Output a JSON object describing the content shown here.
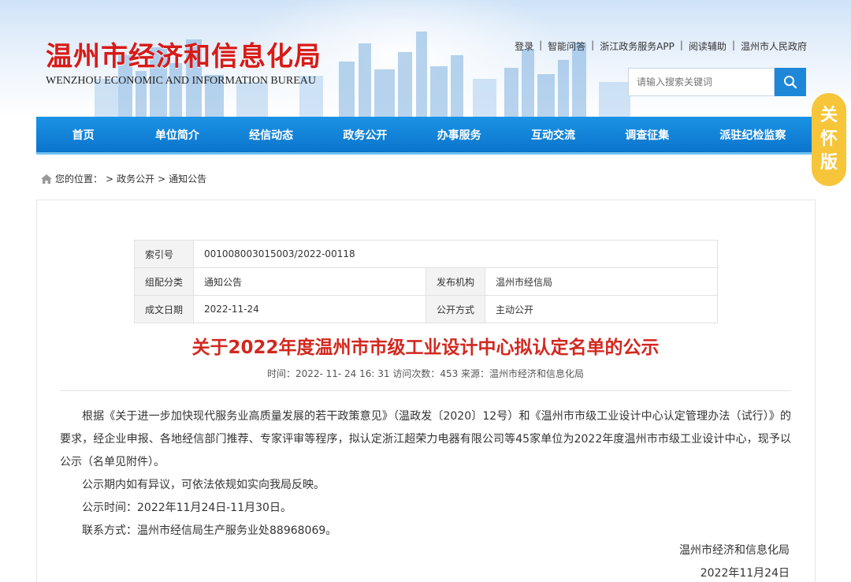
{
  "header": {
    "title": "温州市经济和信息化局",
    "subtitle": "WENZHOU ECONOMIC AND INFORMATION BUREAU",
    "links": [
      "登录",
      "智能问答",
      "浙江政务服务APP",
      "阅读辅助",
      "温州市人民政府"
    ],
    "search_placeholder": "请输入搜索关键词",
    "care_label": [
      "关",
      "怀",
      "版"
    ]
  },
  "nav": [
    "首页",
    "单位简介",
    "经信动态",
    "政务公开",
    "办事服务",
    "互动交流",
    "调查征集",
    "派驻纪检监察"
  ],
  "breadcrumb": {
    "prefix": "您的位置：",
    "sep": ">",
    "items": [
      "政务公开",
      "通知公告"
    ]
  },
  "meta": {
    "index_label": "索引号",
    "index_value": "001008003015003/2022-00118",
    "category_label": "组配分类",
    "category_value": "通知公告",
    "publisher_label": "发布机构",
    "publisher_value": "温州市经信局",
    "date_label": "成文日期",
    "date_value": "2022-11-24",
    "mode_label": "公开方式",
    "mode_value": "主动公开"
  },
  "article": {
    "title": "关于2022年度温州市市级工业设计中心拟认定名单的公示",
    "info": "时间：2022- 11- 24 16: 31 访问次数：453    来源：温州市经济和信息化局",
    "paragraphs": [
      "根据《关于进一步加快现代服务业高质量发展的若干政策意见》（温政发〔2020〕12号）和《温州市市级工业设计中心认定管理办法（试行）》的要求，经企业申报、各地经信部门推荐、专家评审等程序，拟认定浙江超荣力电器有限公司等45家单位为2022年度温州市市级工业设计中心，现予以公示（名单见附件）。",
      "公示期内如有异议，可依法依规如实向我局反映。",
      "公示时间：2022年11月24日-11月30日。",
      "联系方式：温州市经信局生产服务业处88968069。"
    ],
    "sign_org": "温州市经济和信息化局",
    "sign_date": "2022年11月24日"
  }
}
